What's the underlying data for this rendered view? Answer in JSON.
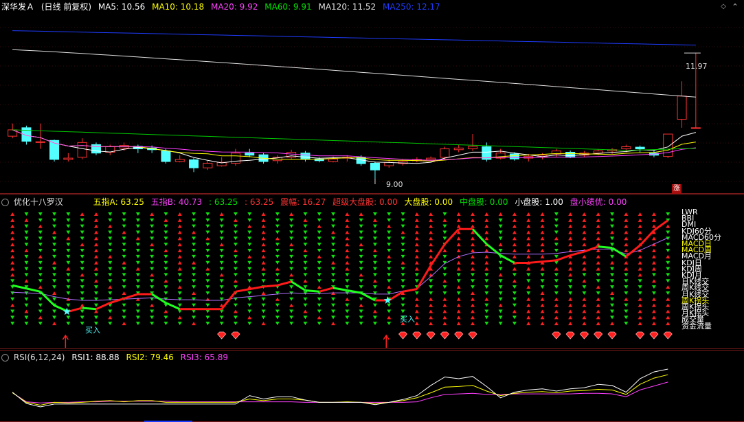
{
  "main": {
    "stock_name": "深华发Ａ",
    "period": "(日线 前复权)",
    "ma": [
      {
        "label": "MA5: 10.56",
        "color": "#ffffff"
      },
      {
        "label": "MA10: 10.18",
        "color": "#ffff00"
      },
      {
        "label": "MA20: 9.92",
        "color": "#ff40ff"
      },
      {
        "label": "MA60: 9.91",
        "color": "#00e000"
      },
      {
        "label": "MA120: 11.52",
        "color": "#e0e0e0"
      },
      {
        "label": "MA250: 12.17",
        "color": "#1e3cff"
      }
    ],
    "high_label": "11.97",
    "low_label": "9.00",
    "zhang_label": "涨",
    "up_color": "#ff3232",
    "down_color": "#54ffff"
  },
  "indicator": {
    "title": "优化十八罗汉",
    "items": [
      {
        "label": "五指A: 63.25",
        "color": "#ffff00"
      },
      {
        "label": "五指B: 40.73",
        "color": "#ff40ff"
      },
      {
        "label": ": 63.25",
        "color": "#00e000"
      },
      {
        "label": ": 63.25",
        "color": "#ff3232"
      },
      {
        "label": "震幅: 16.27",
        "color": "#ff3232"
      },
      {
        "label": "超级大盘股: 0.00",
        "color": "#ff3232"
      },
      {
        "label": "大盘股: 0.00",
        "color": "#ffff00"
      },
      {
        "label": "中盘股: 0.00",
        "color": "#00e000"
      },
      {
        "label": "小盘股: 1.00",
        "color": "#ffffff"
      },
      {
        "label": "盘小绩优: 0.00",
        "color": "#ff40ff"
      }
    ],
    "buy_label": "买入",
    "right_labels": [
      {
        "text": "LWR",
        "color": "#ffffff"
      },
      {
        "text": "BBI",
        "color": "#ffffff"
      },
      {
        "text": "DMI",
        "color": "#ffffff"
      },
      {
        "text": "KDJ60分",
        "color": "#ffffff"
      },
      {
        "text": "MACD60分",
        "color": "#ffffff"
      },
      {
        "text": "MACD日",
        "color": "#ffff00"
      },
      {
        "text": "MACD周",
        "color": "#ffff00"
      },
      {
        "text": "MACD月",
        "color": "#ffffff"
      },
      {
        "text": "KDJ日",
        "color": "#ffffff"
      },
      {
        "text": "KDJ周",
        "color": "#ffffff"
      },
      {
        "text": "KDJ月",
        "color": "#ffffff"
      },
      {
        "text": "日K线交",
        "color": "#ffffff"
      },
      {
        "text": "周K线交",
        "color": "#ffffff"
      },
      {
        "text": "月K线交",
        "color": "#ffffff"
      },
      {
        "text": "周K拐头",
        "color": "#ffff00"
      },
      {
        "text": "周K拐头",
        "color": "#ffffff"
      },
      {
        "text": "月K拐头",
        "color": "#ffffff"
      },
      {
        "text": "成交量",
        "color": "#ffffff"
      },
      {
        "text": "资金流量",
        "color": "#ffffff"
      }
    ]
  },
  "rsi": {
    "title": "RSI(6,12,24)",
    "items": [
      {
        "label": "RSI1: 88.88",
        "color": "#ffffff"
      },
      {
        "label": "RSI2: 79.46",
        "color": "#ffff00"
      },
      {
        "label": "RSI3: 65.89",
        "color": "#ff40ff"
      }
    ]
  },
  "chart_data": [
    {
      "type": "candlestick",
      "series": [
        {
          "name": "MA5"
        },
        {
          "name": "MA10"
        },
        {
          "name": "MA20"
        },
        {
          "name": "MA60"
        },
        {
          "name": "MA120"
        },
        {
          "name": "MA250"
        }
      ],
      "candles": [
        [
          10.0,
          10.15,
          10.3,
          9.95
        ],
        [
          10.2,
          9.88,
          10.25,
          9.8
        ],
        [
          9.85,
          9.87,
          10.3,
          9.7
        ],
        [
          9.9,
          9.45,
          9.92,
          9.4
        ],
        [
          9.45,
          9.48,
          9.6,
          9.4
        ],
        [
          9.5,
          9.85,
          9.95,
          9.45
        ],
        [
          9.8,
          9.6,
          9.85,
          9.55
        ],
        [
          9.62,
          9.75,
          9.8,
          9.55
        ],
        [
          9.72,
          9.78,
          9.85,
          9.65
        ],
        [
          9.76,
          9.7,
          9.8,
          9.6
        ],
        [
          9.72,
          9.68,
          9.78,
          9.6
        ],
        [
          9.65,
          9.4,
          9.7,
          9.35
        ],
        [
          9.4,
          9.45,
          9.55,
          9.38
        ],
        [
          9.44,
          9.25,
          9.48,
          9.15
        ],
        [
          9.25,
          9.36,
          9.42,
          9.2
        ],
        [
          9.3,
          9.38,
          9.5,
          9.28
        ],
        [
          9.36,
          9.6,
          9.7,
          9.3
        ],
        [
          9.6,
          9.55,
          9.7,
          9.5
        ],
        [
          9.56,
          9.4,
          9.6,
          9.35
        ],
        [
          9.42,
          9.5,
          9.55,
          9.35
        ],
        [
          9.5,
          9.62,
          9.68,
          9.45
        ],
        [
          9.6,
          9.45,
          9.65,
          9.4
        ],
        [
          9.46,
          9.42,
          9.5,
          9.38
        ],
        [
          9.4,
          9.46,
          9.52,
          9.38
        ],
        [
          9.48,
          9.5,
          9.55,
          9.4
        ],
        [
          9.5,
          9.35,
          9.55,
          9.3
        ],
        [
          9.36,
          9.2,
          9.4,
          9.0
        ],
        [
          9.3,
          9.38,
          9.45,
          9.25
        ],
        [
          9.35,
          9.4,
          9.45,
          9.3
        ],
        [
          9.42,
          9.45,
          9.5,
          9.38
        ],
        [
          9.44,
          9.48,
          9.52,
          9.4
        ],
        [
          9.5,
          9.7,
          9.75,
          9.45
        ],
        [
          9.68,
          9.72,
          9.8,
          9.62
        ],
        [
          9.7,
          9.76,
          10.05,
          9.65
        ],
        [
          9.75,
          9.45,
          9.85,
          9.4
        ],
        [
          9.48,
          9.6,
          9.7,
          9.45
        ],
        [
          9.58,
          9.46,
          9.62,
          9.42
        ],
        [
          9.48,
          9.52,
          9.58,
          9.4
        ],
        [
          9.5,
          9.55,
          9.6,
          9.45
        ],
        [
          9.58,
          9.65,
          9.7,
          9.5
        ],
        [
          9.62,
          9.5,
          9.66,
          9.48
        ],
        [
          9.55,
          9.6,
          9.65,
          9.5
        ],
        [
          9.6,
          9.65,
          9.7,
          9.55
        ],
        [
          9.65,
          9.68,
          9.72,
          9.58
        ],
        [
          9.7,
          9.75,
          9.8,
          9.62
        ],
        [
          9.74,
          9.7,
          9.78,
          9.62
        ],
        [
          9.6,
          9.55,
          9.66,
          9.5
        ],
        [
          9.52,
          10.05,
          10.05,
          9.48
        ],
        [
          10.4,
          10.95,
          11.3,
          10.2
        ],
        [
          10.2,
          10.2,
          11.97,
          10.2
        ]
      ]
    },
    {
      "type": "line",
      "series": [
        {
          "name": ""
        },
        {
          "name": ""
        }
      ],
      "trend": [
        40.0,
        37.5,
        35.0,
        24.0,
        19.0,
        22.0,
        21.0,
        26.0,
        29.5,
        33.0,
        33.0,
        26.0,
        21.0,
        21.0,
        21.0,
        21.0,
        35.0,
        37.0,
        39.0,
        40.0,
        43.0,
        36.0,
        35.0,
        38.0,
        36.0,
        34.0,
        28.0,
        28.0,
        35.0,
        37.0,
        56.0,
        73.0,
        85.0,
        85.0,
        73.0,
        64.0,
        58.0,
        58.0,
        59.0,
        60.0,
        64.0,
        67.0,
        71.0,
        70.0,
        63.0,
        72.0,
        84.0,
        92.0
      ],
      "avg": [
        34.5,
        34.0,
        33.5,
        31.0,
        29.0,
        28.0,
        28.0,
        28.5,
        29.0,
        29.5,
        30.0,
        29.0,
        28.5,
        28.5,
        28.0,
        28.0,
        30.0,
        31.0,
        32.0,
        33.0,
        34.0,
        33.5,
        33.5,
        34.0,
        34.0,
        34.0,
        33.0,
        33.0,
        35.5,
        37.5,
        47.0,
        57.5,
        63.0,
        66.0,
        66.5,
        65.5,
        65.0,
        65.0,
        65.0,
        65.5,
        67.0,
        68.0,
        69.0,
        69.0,
        65.0,
        68.0,
        73.0,
        78.0
      ],
      "ylim": [
        0,
        100
      ]
    },
    {
      "type": "line",
      "series": [
        {
          "name": "RSI1"
        },
        {
          "name": "RSI2"
        },
        {
          "name": "RSI3"
        }
      ],
      "rsi1": [
        48,
        28,
        22,
        27,
        27,
        27,
        27,
        27,
        27,
        27,
        27,
        27,
        27,
        27,
        27,
        27,
        27,
        42,
        36,
        40,
        40,
        34,
        30,
        30,
        30,
        30,
        26,
        30,
        35,
        42,
        60,
        75,
        72,
        76,
        58,
        38,
        48,
        52,
        54,
        50,
        54,
        56,
        62,
        60,
        48,
        72,
        84,
        89
      ],
      "rsi2": [
        47,
        30,
        25,
        30,
        29,
        30,
        32,
        33,
        31,
        33,
        33,
        30,
        30,
        30,
        30,
        30,
        30,
        36,
        33,
        36,
        36,
        34,
        30,
        30,
        31,
        30,
        28,
        30,
        33,
        38,
        47,
        57,
        58,
        60,
        50,
        42,
        46,
        48,
        49,
        47,
        50,
        51,
        53,
        52,
        44,
        62,
        73,
        79
      ],
      "rsi3": [
        47,
        31,
        29,
        30,
        30,
        31,
        31,
        32,
        32,
        32,
        32,
        32,
        31,
        31,
        31,
        31,
        31,
        31,
        31,
        31,
        31,
        30,
        30,
        30,
        30,
        30,
        30,
        30,
        30,
        31,
        38,
        44,
        45,
        46,
        44,
        44,
        45,
        45,
        45,
        45,
        45,
        46,
        46,
        45,
        40,
        52,
        59,
        66
      ],
      "ylim": [
        0,
        100
      ]
    }
  ]
}
